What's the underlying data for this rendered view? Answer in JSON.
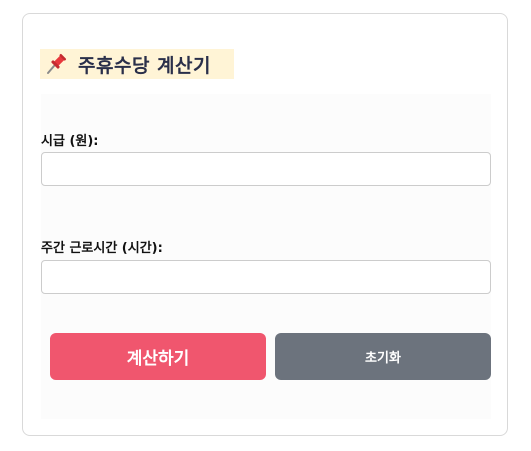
{
  "app": {
    "title": "주휴수당 계산기",
    "title_icon": "pushpin-icon"
  },
  "form": {
    "wage_label": "시급 (원):",
    "wage_value": "",
    "hours_label": "주간 근로시간 (시간):",
    "hours_value": ""
  },
  "buttons": {
    "calculate_label": "계산하기",
    "reset_label": "초기화"
  },
  "colors": {
    "calculate_bg": "#f0566e",
    "reset_bg": "#6c737d",
    "title_highlight": "#fff4d6",
    "pin_red": "#e8383d"
  }
}
